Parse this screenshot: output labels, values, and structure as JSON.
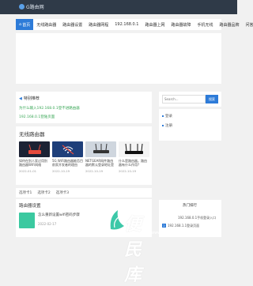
{
  "header": {
    "site_name": "G路由网"
  },
  "nav": {
    "items": [
      "首页",
      "无线路由器",
      "路由器设置",
      "路由器网程",
      "192.168.0.1",
      "路由器上网",
      "路由器故障",
      "手机无线",
      "路由器品牌",
      "问答"
    ]
  },
  "notice": {
    "title": "特别推荐",
    "links": [
      "为什么输入192.168.0.1登不进路由器",
      "192.168.0.1登陆页面"
    ]
  },
  "search": {
    "placeholder": "Search...",
    "button": "搜索"
  },
  "sidebar_links": [
    "登录",
    "注册"
  ],
  "wireless": {
    "heading": "无线路由器",
    "cards": [
      {
        "title": "如何在别人家过用别路由器WiFi网络",
        "date": "2022-01-01"
      },
      {
        "title": "5G WiFi路由器能否目前家开发者的理由",
        "date": "2022-10-19"
      },
      {
        "title": "NETGEAR网件路由器的默认登录地址是什么",
        "date": "2022-10-19"
      },
      {
        "title": "什么是路由器，路由器有什么作用?",
        "date": "2022-10-19"
      }
    ]
  },
  "tabs": [
    "选项卡1",
    "选项卡2",
    "选项卡3"
  ],
  "router_setting": {
    "heading": "路由器设置",
    "article": {
      "title": "怎么重新设置wifi密码步骤",
      "date": "2022-02-17"
    }
  },
  "rank": {
    "heading": "热门排行",
    "item1": "192.168.0.1手机登录入口",
    "item2": "192.168.1.1登录页面",
    "num": "2"
  },
  "watermark": {
    "text": "便民库",
    "url": "www.bianmink.com"
  }
}
